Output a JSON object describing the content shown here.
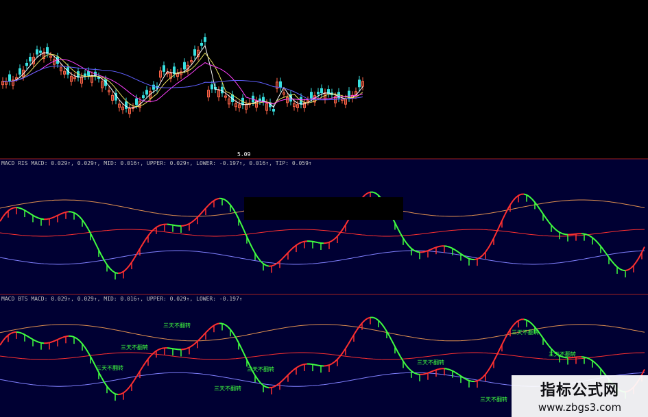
{
  "chart_data": [
    {
      "type": "candlestick",
      "panel": "price",
      "annotations": [
        "5.09"
      ],
      "lines": [
        "ma5",
        "ma10",
        "ma20",
        "ma60"
      ]
    },
    {
      "type": "line",
      "panel": "macd-1",
      "header": "MACD RIS MACD: 0.029↑, 0.029↑, MID: 0.016↑, UPPER: 0.029↑, LOWER: -0.197↑, 0.016↑, TIP: 0.059↑"
    },
    {
      "type": "line",
      "panel": "macd-2",
      "header": "MACD BTS MACD: 0.029↑, 0.029↑, MID: 0.016↑, UPPER: 0.029↑, LOWER: -0.197↑",
      "signal_label": "三天不翻转"
    }
  ],
  "colors": {
    "up": "#ff6347",
    "down": "#38e0e0",
    "ma1": "#ffffff",
    "ma2": "#e8e060",
    "ma3": "#ff40ff",
    "ma4": "#6060ff",
    "macd_up": "#ff3030",
    "macd_down": "#40ff40",
    "upper_band": "#e09050",
    "lower_band": "#8080ff",
    "panel_bg": "#000033",
    "signal": "#40ff40"
  },
  "watermark": {
    "title": "指标公式网",
    "url": "www.zbgs3.com"
  }
}
